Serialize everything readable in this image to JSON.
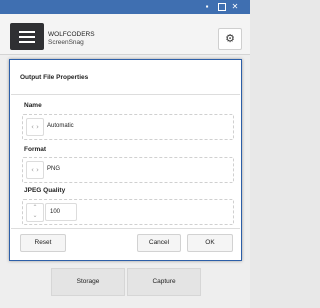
{
  "window": {
    "titlebar_color": "#3f6fb1",
    "controls": {
      "minimize": "▪",
      "close": "✕"
    }
  },
  "header": {
    "menu_icon": "hamburger-icon",
    "app_name": "WOLFCODERS",
    "app_subtitle": "ScreenSnag",
    "settings_icon": "gear-icon",
    "gear_glyph": "⚙"
  },
  "dialog": {
    "title": "Output File Properties",
    "border_color": "#2d5fa8",
    "fields": {
      "name": {
        "label": "Name",
        "value": "Automatic",
        "icon": "code-icon",
        "icon_glyph": "‹ ›"
      },
      "format": {
        "label": "Format",
        "value": "PNG",
        "icon": "code-icon",
        "icon_glyph": "‹ ›"
      },
      "jpeg_quality": {
        "label": "JPEG Quality",
        "value": "100",
        "up_glyph": "⌃",
        "down_glyph": "⌄"
      }
    },
    "buttons": {
      "reset": "Reset",
      "cancel": "Cancel",
      "ok": "OK"
    }
  },
  "bottom": {
    "storage": "Storage",
    "capture": "Capture"
  }
}
